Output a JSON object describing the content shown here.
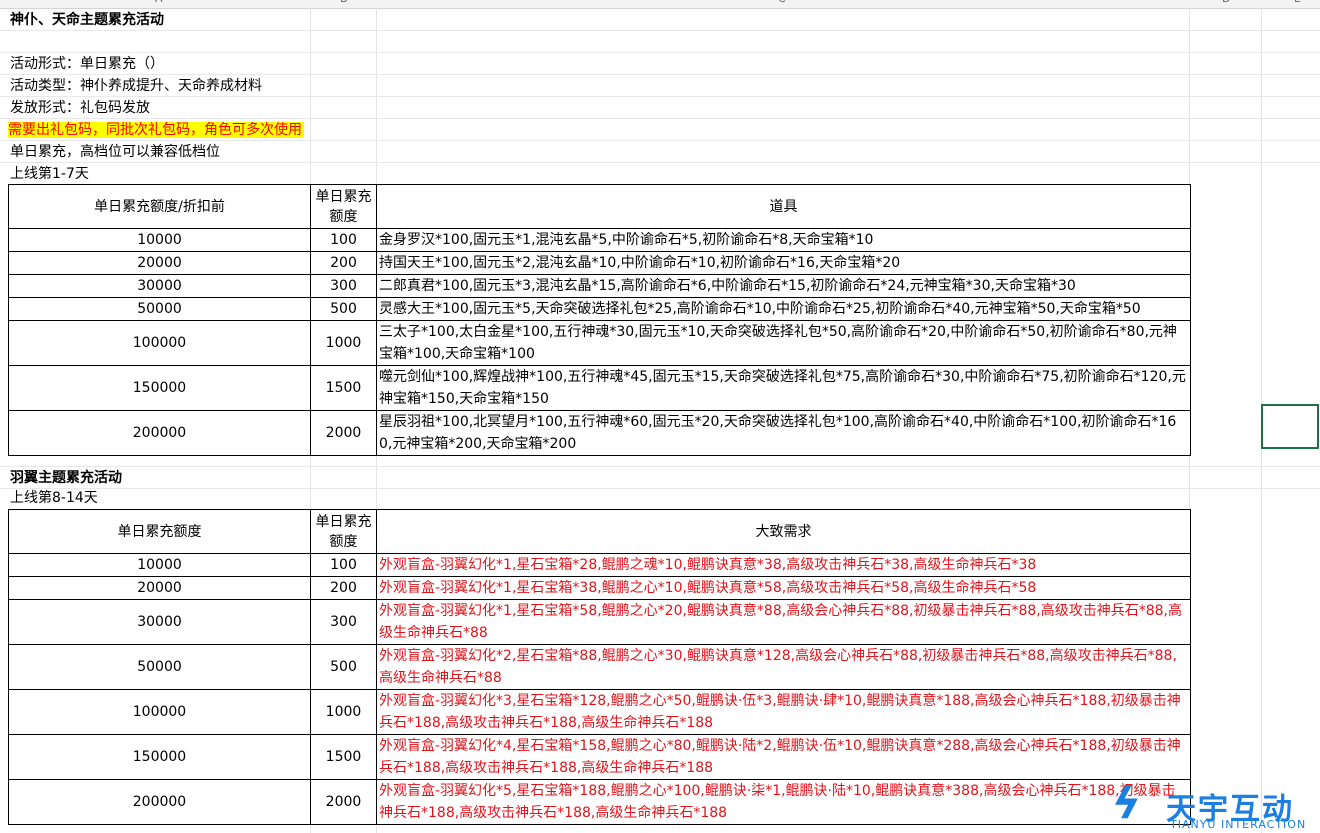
{
  "columns": [
    "A",
    "B",
    "C",
    "D",
    "E"
  ],
  "section1": {
    "title": "神仆、天命主题累充活动",
    "lines": [
      "活动形式：单日累充（）",
      "活动类型：神仆养成提升、天命养成材料",
      "发放形式：礼包码发放"
    ],
    "highlight": "需要出礼包码，同批次礼包码，角色可多次使用",
    "note": "单日累充，高档位可以兼容低档位",
    "period": "上线第1-7天",
    "headers": [
      "单日累充额度/折扣前",
      "单日累充额度",
      "道具"
    ],
    "rows": [
      {
        "amount": "10000",
        "points": "100",
        "items": "金身罗汉*100,固元玉*1,混沌玄晶*5,中阶谕命石*5,初阶谕命石*8,天命宝箱*10"
      },
      {
        "amount": "20000",
        "points": "200",
        "items": "持国天王*100,固元玉*2,混沌玄晶*10,中阶谕命石*10,初阶谕命石*16,天命宝箱*20"
      },
      {
        "amount": "30000",
        "points": "300",
        "items": "二郎真君*100,固元玉*3,混沌玄晶*15,高阶谕命石*6,中阶谕命石*15,初阶谕命石*24,元神宝箱*30,天命宝箱*30"
      },
      {
        "amount": "50000",
        "points": "500",
        "items": "灵感大王*100,固元玉*5,天命突破选择礼包*25,高阶谕命石*10,中阶谕命石*25,初阶谕命石*40,元神宝箱*50,天命宝箱*50"
      },
      {
        "amount": "100000",
        "points": "1000",
        "items": "三太子*100,太白金星*100,五行神魂*30,固元玉*10,天命突破选择礼包*50,高阶谕命石*20,中阶谕命石*50,初阶谕命石*80,元神宝箱*100,天命宝箱*100"
      },
      {
        "amount": "150000",
        "points": "1500",
        "items": "噬元剑仙*100,辉煌战神*100,五行神魂*45,固元玉*15,天命突破选择礼包*75,高阶谕命石*30,中阶谕命石*75,初阶谕命石*120,元神宝箱*150,天命宝箱*150"
      },
      {
        "amount": "200000",
        "points": "2000",
        "items": "星辰羽祖*100,北冥望月*100,五行神魂*60,固元玉*20,天命突破选择礼包*100,高阶谕命石*40,中阶谕命石*100,初阶谕命石*160,元神宝箱*200,天命宝箱*200"
      }
    ]
  },
  "section2": {
    "title": "羽翼主题累充活动",
    "period": "上线第8-14天",
    "headers": [
      "单日累充额度",
      "单日累充额度",
      "大致需求"
    ],
    "rows": [
      {
        "amount": "10000",
        "points": "100",
        "items": "外观盲盒-羽翼幻化*1,星石宝箱*28,鲲鹏之魂*10,鲲鹏诀真意*38,高级攻击神兵石*38,高级生命神兵石*38"
      },
      {
        "amount": "20000",
        "points": "200",
        "items": "外观盲盒-羽翼幻化*1,星石宝箱*38,鲲鹏之心*10,鲲鹏诀真意*58,高级攻击神兵石*58,高级生命神兵石*58"
      },
      {
        "amount": "30000",
        "points": "300",
        "items": "外观盲盒-羽翼幻化*1,星石宝箱*58,鲲鹏之心*20,鲲鹏诀真意*88,高级会心神兵石*88,初级暴击神兵石*88,高级攻击神兵石*88,高级生命神兵石*88"
      },
      {
        "amount": "50000",
        "points": "500",
        "items": "外观盲盒-羽翼幻化*2,星石宝箱*88,鲲鹏之心*30,鲲鹏诀真意*128,高级会心神兵石*88,初级暴击神兵石*88,高级攻击神兵石*88,高级生命神兵石*88"
      },
      {
        "amount": "100000",
        "points": "1000",
        "items": "外观盲盒-羽翼幻化*3,星石宝箱*128,鲲鹏之心*50,鲲鹏诀·伍*3,鲲鹏诀·肆*10,鲲鹏诀真意*188,高级会心神兵石*188,初级暴击神兵石*188,高级攻击神兵石*188,高级生命神兵石*188"
      },
      {
        "amount": "150000",
        "points": "1500",
        "items": "外观盲盒-羽翼幻化*4,星石宝箱*158,鲲鹏之心*80,鲲鹏诀·陆*2,鲲鹏诀·伍*10,鲲鹏诀真意*288,高级会心神兵石*188,初级暴击神兵石*188,高级攻击神兵石*188,高级生命神兵石*188"
      },
      {
        "amount": "200000",
        "points": "2000",
        "items": "外观盲盒-羽翼幻化*5,星石宝箱*188,鲲鹏之心*100,鲲鹏诀·柒*1,鲲鹏诀·陆*10,鲲鹏诀真意*388,高级会心神兵石*188,初级暴击神兵石*188,高级攻击神兵石*188,高级生命神兵石*188"
      }
    ]
  },
  "watermark": {
    "name": "天宇互动",
    "en": "TIANYU INTERACTION"
  },
  "colors": {
    "highlight_bg": "#ffff00",
    "highlight_text": "#ff0000",
    "section2_text": "#e0141b",
    "selection": "#1e7145"
  }
}
